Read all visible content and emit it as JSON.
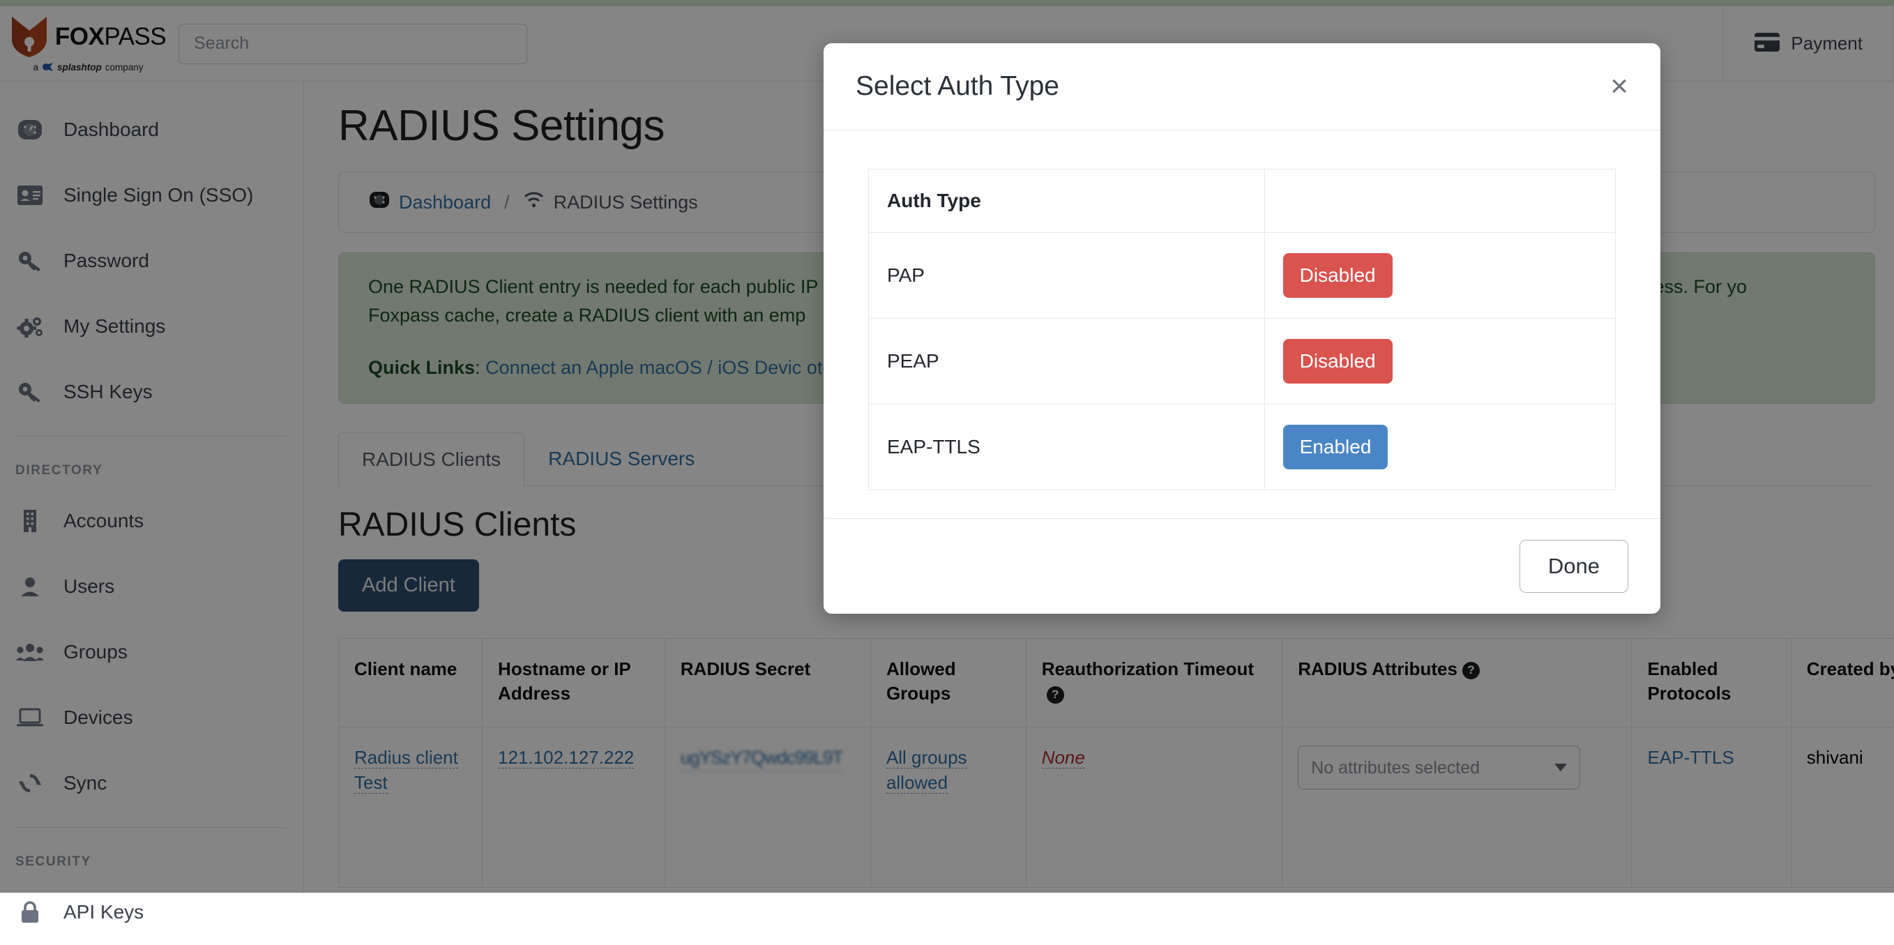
{
  "brand": {
    "name_bold": "FOX",
    "name_thin": "PASS",
    "tagline_prefix": "a",
    "tagline_brand": "splashtop",
    "tagline_suffix": "company"
  },
  "search": {
    "placeholder": "Search"
  },
  "header": {
    "payment_label": "Payment",
    "payment_icon": "credit-card-icon"
  },
  "sidebar": {
    "items": [
      {
        "label": "Dashboard",
        "icon": "gauge-icon"
      },
      {
        "label": "Single Sign On (SSO)",
        "icon": "id-card-icon"
      },
      {
        "label": "Password",
        "icon": "key-icon"
      },
      {
        "label": "My Settings",
        "icon": "gears-icon"
      },
      {
        "label": "SSH Keys",
        "icon": "key-icon"
      }
    ],
    "group_directory": "DIRECTORY",
    "directory_items": [
      {
        "label": "Accounts",
        "icon": "building-icon"
      },
      {
        "label": "Users",
        "icon": "user-icon"
      },
      {
        "label": "Groups",
        "icon": "users-icon"
      },
      {
        "label": "Devices",
        "icon": "laptop-icon"
      },
      {
        "label": "Sync",
        "icon": "sync-icon"
      }
    ],
    "group_security": "SECURITY",
    "security_items": [
      {
        "label": "API Keys",
        "icon": "lock-icon"
      }
    ]
  },
  "main": {
    "page_title": "RADIUS Settings",
    "breadcrumb": {
      "home_label": "Dashboard",
      "home_icon": "gauge-icon",
      "separator": "/",
      "current_label": "RADIUS Settings",
      "current_icon": "wifi-icon"
    },
    "alert": {
      "line1": "One RADIUS Client entry is needed for each public IP address that RADIUS requests will originate from. This is usually your office or device's NAT IP address. For yo",
      "line2": "Foxpass cache, create a RADIUS client with an emp",
      "quick_links_label": "Quick Links",
      "quick_links_colon": ":",
      "link1": "Connect an Apple macOS / iOS Devic",
      "link2": "otocols"
    },
    "tabs": [
      {
        "label": "RADIUS Clients",
        "active": true
      },
      {
        "label": "RADIUS Servers",
        "active": false
      }
    ],
    "section_title": "RADIUS Clients",
    "add_client_label": "Add Client"
  },
  "clients_table": {
    "columns": [
      "Client name",
      "Hostname or IP Address",
      "RADIUS Secret",
      "Allowed Groups",
      "Reauthorization Timeout",
      "RADIUS Attributes",
      "Enabled Protocols",
      "Created by"
    ],
    "help_icon": "?",
    "rows": [
      {
        "client_name": "Radius client Test",
        "hostname": "121.102.127.222",
        "secret": "ugYSzY7Qwdc99L9T",
        "allowed_groups": "All groups allowed",
        "reauth_timeout": "None",
        "attributes_value": "No attributes selected",
        "enabled_protocols": "EAP-TTLS",
        "created_by": "shivani"
      }
    ]
  },
  "modal": {
    "title": "Select Auth Type",
    "close_label": "×",
    "table_header": "Auth Type",
    "rows": [
      {
        "name": "PAP",
        "status": "Disabled",
        "state": "disabled"
      },
      {
        "name": "PEAP",
        "status": "Disabled",
        "state": "disabled"
      },
      {
        "name": "EAP-TTLS",
        "status": "Enabled",
        "state": "enabled"
      }
    ],
    "done_label": "Done"
  },
  "colors": {
    "danger": "#d9534f",
    "primary_blue": "#4a86c5",
    "brand_navy": "#2b4d70",
    "link": "#2f6fa7",
    "alert_green_bg": "#d8e9d6",
    "alert_green_text": "#1c4a21",
    "logo_orange": "#b8471f"
  }
}
